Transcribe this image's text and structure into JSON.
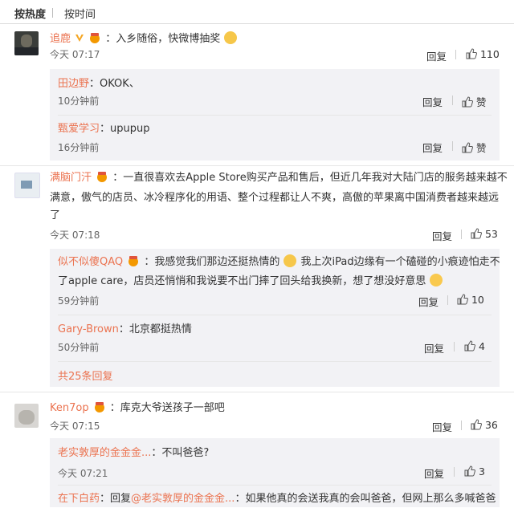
{
  "tabs": {
    "hot": "按热度",
    "time": "按时间"
  },
  "comments": [
    {
      "name": "追鹿",
      "text": "：入乡随俗，快微博抽奖",
      "time": "今天 07:17",
      "reply": "回复",
      "likes": "110",
      "sub": [
        {
          "name": "田边野",
          "text": "：OKOK、",
          "time": "10分钟前",
          "reply": "回复",
          "likes": "赞"
        },
        {
          "name": "甄爱学习",
          "text": "：upupup",
          "time": "16分钟前",
          "reply": "回复",
          "likes": "赞"
        }
      ]
    },
    {
      "name": "满脑门汗",
      "text_line1": "：一直很喜欢去Apple Store购买产品和售后，但近几年我对大陆门店的服务越来越不",
      "text_line2": "满意，傲气的店员、冰冷程序化的用语、整个过程都让人不爽，高傲的苹果离中国消费者越来越远",
      "text_line3": "了",
      "time": "今天 07:18",
      "reply": "回复",
      "likes": "53",
      "sub": [
        {
          "name": "似不似傻QAQ",
          "text_line1a": "：我感觉我们那边还挺热情的",
          "text_line1b": "我上次iPad边缘有一个磕碰的小痕迹怕走不",
          "text_line2": "了apple care，店员还悄悄和我说要不出门摔了回头给我换新，想了想没好意思",
          "time": "59分钟前",
          "reply": "回复",
          "likes": "10"
        },
        {
          "name": "Gary-Brown",
          "text": "：北京都挺热情",
          "time": "50分钟前",
          "reply": "回复",
          "likes": "4"
        }
      ],
      "more": "共25条回复"
    },
    {
      "name": "Ken7op",
      "text": "：库克大爷送孩子一部吧",
      "time": "今天 07:15",
      "reply": "回复",
      "likes": "36",
      "sub": [
        {
          "name": "老实敦厚的金金金...",
          "text": "：不叫爸爸?",
          "time": "今天 07:21",
          "reply": "回复",
          "likes": "3"
        },
        {
          "name": "在下白药",
          "reply_prefix": "：回复",
          "mention": "@老实敦厚的金金金...",
          "text": "：如果他真的会送我真的会叫爸爸，但网上那么多喊爸爸"
        }
      ]
    }
  ]
}
